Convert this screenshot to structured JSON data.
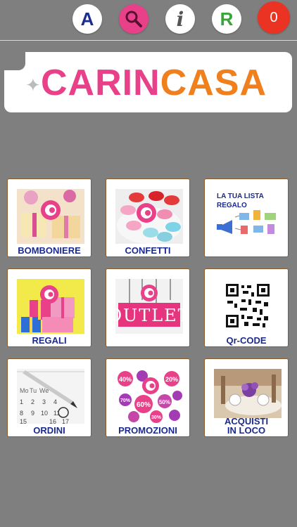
{
  "topbar": {
    "a_label": "A",
    "info_label": "i",
    "r_label": "R",
    "cart_count": "0",
    "icons": [
      "search-icon",
      "info-icon",
      "cart-badge"
    ]
  },
  "logo": {
    "part1": "CARIN",
    "part2": "CASA"
  },
  "tiles": [
    {
      "label": "BOMBONIERE",
      "icon": "bomboniere-image"
    },
    {
      "label": "CONFETTI",
      "icon": "confetti-image"
    },
    {
      "label": "",
      "icon": "gift-list-image",
      "image_text": "LA TUA LISTA REGALO"
    },
    {
      "label": "REGALI",
      "icon": "gifts-image"
    },
    {
      "label": "",
      "icon": "outlet-image",
      "image_text": "OUTLET"
    },
    {
      "label": "Qr-CODE",
      "icon": "qr-code-image"
    },
    {
      "label": "ORDINI",
      "icon": "calendar-pen-image",
      "image_text": [
        "Mo",
        "Tu",
        "We",
        "1",
        "2",
        "3",
        "4",
        "8",
        "9",
        "10",
        "11",
        "15",
        "16",
        "17"
      ]
    },
    {
      "label": "PROMOZIONI",
      "icon": "promotions-image",
      "image_text": [
        "40%",
        "20%",
        "60%",
        "50%",
        "70%",
        "30%"
      ]
    },
    {
      "label": "ACQUISTI IN LOCO",
      "label_line1": "ACQUISTI",
      "label_line2": "IN LOCO",
      "icon": "in-store-image"
    }
  ],
  "colors": {
    "background": "#7f7f7f",
    "brand_pink": "#e8418a",
    "brand_orange": "#f07f1e",
    "label_blue": "#1a2a8c",
    "cart_red": "#ea3323"
  }
}
